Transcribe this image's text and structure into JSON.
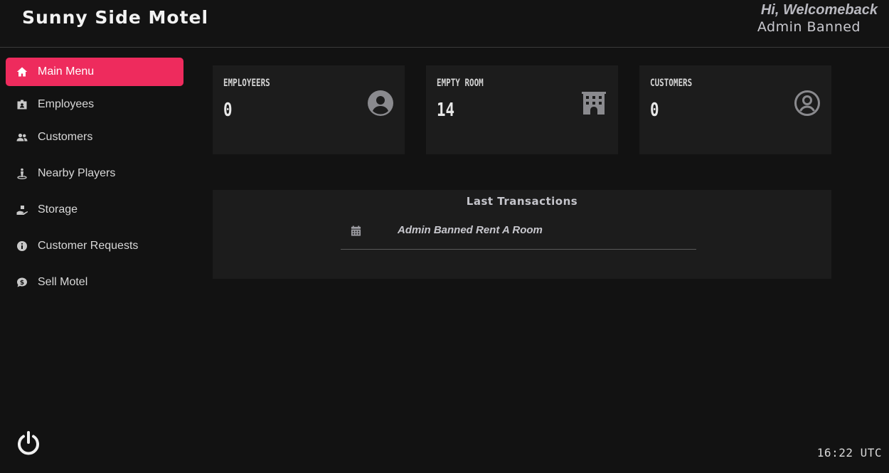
{
  "header": {
    "title": "Sunny Side Motel",
    "greeting": "Hi, Welcomeback",
    "user": "Admin Banned"
  },
  "sidebar": {
    "items": [
      {
        "label": "Main Menu",
        "icon": "home-icon",
        "active": true
      },
      {
        "label": "Employees",
        "icon": "id-badge-icon"
      },
      {
        "label": "Customers",
        "icon": "users-icon"
      },
      {
        "label": "Nearby Players",
        "icon": "person-pin-icon"
      },
      {
        "label": "Storage",
        "icon": "hand-box-icon"
      },
      {
        "label": "Customer Requests",
        "icon": "info-circle-icon"
      },
      {
        "label": "Sell Motel",
        "icon": "money-bubble-icon"
      }
    ]
  },
  "stats": [
    {
      "label": "EMPLOYEERS",
      "value": "0",
      "icon": "user-circle-icon"
    },
    {
      "label": "EMPTY ROOM",
      "value": "14",
      "icon": "building-icon"
    },
    {
      "label": "CUSTOMERS",
      "value": "0",
      "icon": "user-circle-outline-icon"
    }
  ],
  "transactions": {
    "title": "Last Transactions",
    "items": [
      {
        "text": "Admin Banned Rent A Room",
        "icon": "calendar-icon"
      }
    ]
  },
  "footer": {
    "clock": "16:22 UTC",
    "power_icon": "power-icon"
  },
  "colors": {
    "accent": "#ee2b5d",
    "background": "#121212",
    "card": "#1c1c1c"
  }
}
